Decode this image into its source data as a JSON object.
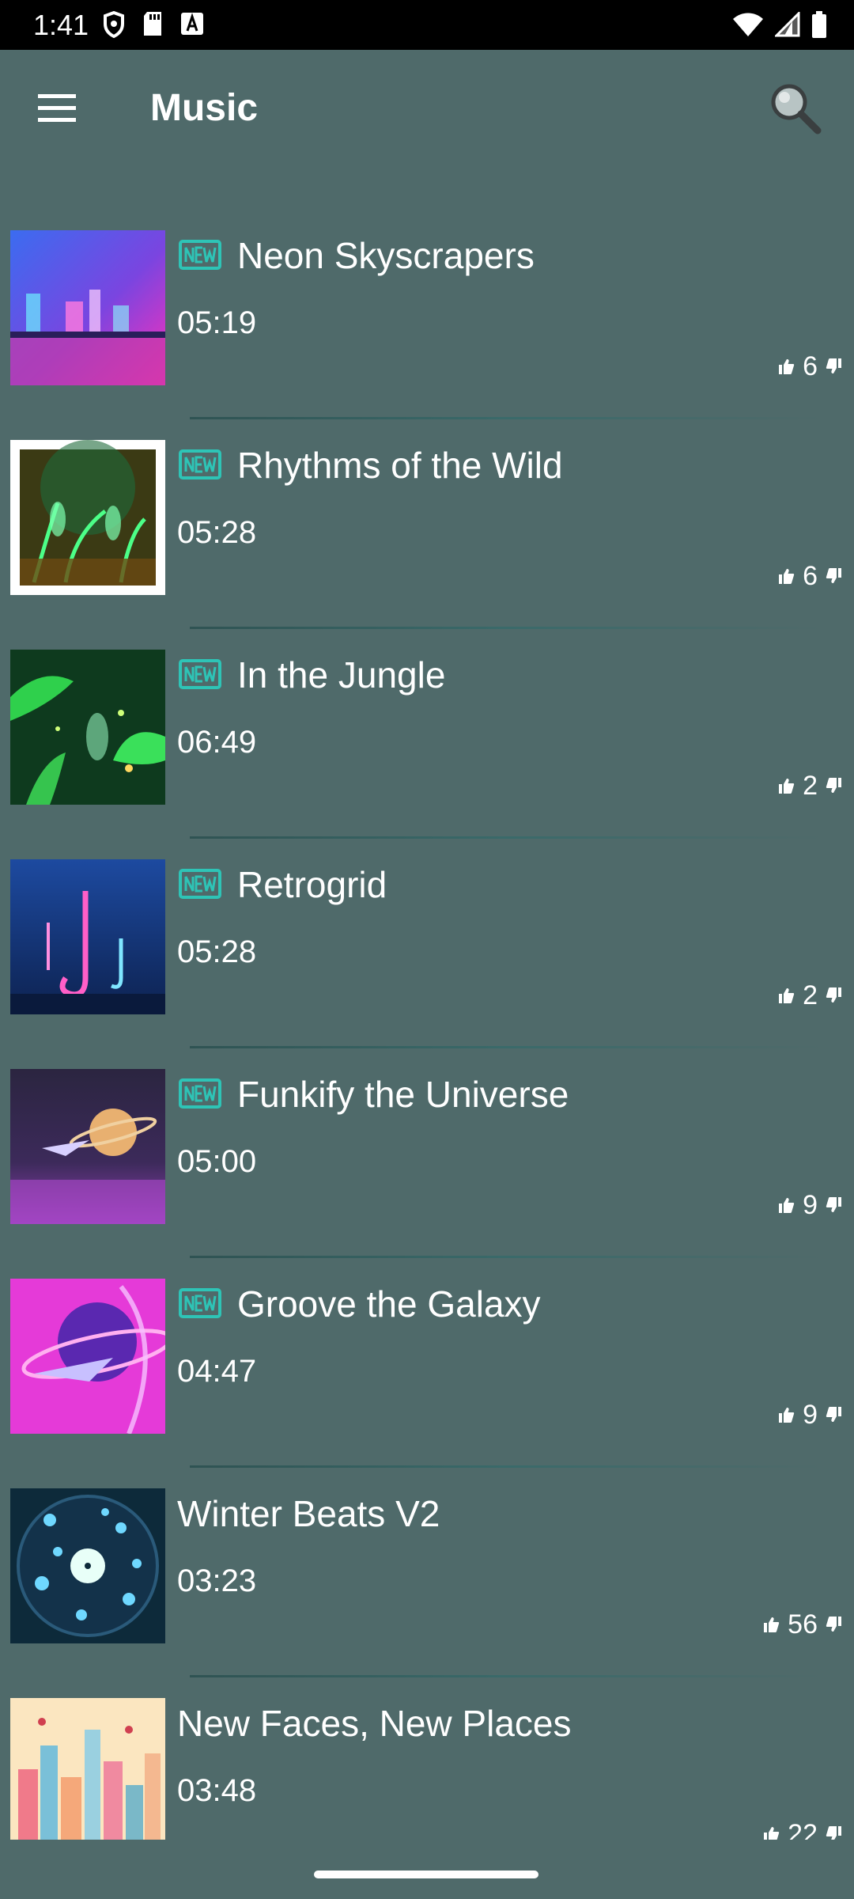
{
  "status_bar": {
    "time": "1:41",
    "icons": [
      "shield-icon",
      "sd-card-icon",
      "font-icon",
      "wifi-icon",
      "signal-icon",
      "battery-icon"
    ]
  },
  "app_bar": {
    "title": "Music",
    "menu_icon": "hamburger-menu-icon",
    "search_icon": "search-icon"
  },
  "colors": {
    "background": "#4f6a6a",
    "accent_badge": "#2ec4b6",
    "status_bar": "#000000"
  },
  "tracks": [
    {
      "title": "Neon Skyscrapers",
      "duration": "05:19",
      "likes": "6",
      "is_new": true
    },
    {
      "title": "Rhythms of the Wild",
      "duration": "05:28",
      "likes": "6",
      "is_new": true
    },
    {
      "title": "In the Jungle",
      "duration": "06:49",
      "likes": "2",
      "is_new": true
    },
    {
      "title": "Retrogrid",
      "duration": "05:28",
      "likes": "2",
      "is_new": true
    },
    {
      "title": "Funkify the Universe",
      "duration": "05:00",
      "likes": "9",
      "is_new": true
    },
    {
      "title": "Groove the Galaxy",
      "duration": "04:47",
      "likes": "9",
      "is_new": true
    },
    {
      "title": "Winter Beats V2",
      "duration": "03:23",
      "likes": "56",
      "is_new": false
    },
    {
      "title": "New Faces, New Places",
      "duration": "03:48",
      "likes": "22",
      "is_new": false
    }
  ]
}
